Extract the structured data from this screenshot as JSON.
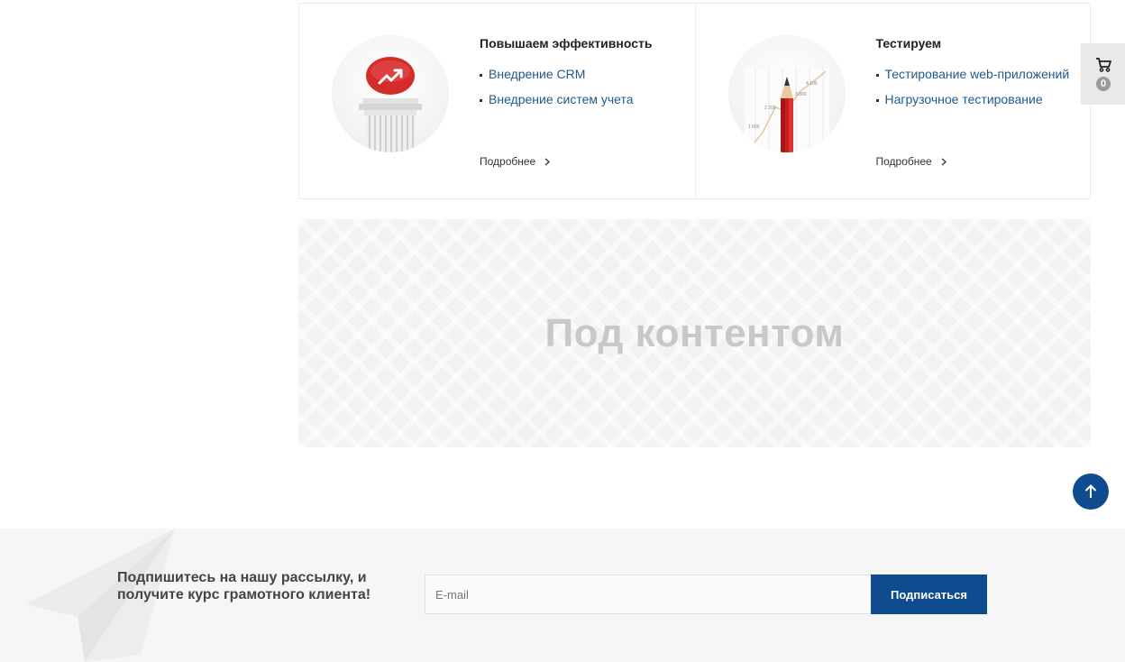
{
  "services": [
    {
      "title": "Повышаем эффективность",
      "items": [
        "Внедрение CRM",
        "Внедрение систем учета"
      ],
      "more_label": "Подробнее",
      "icon": "column-growth-icon"
    },
    {
      "title": "Тестируем",
      "items": [
        "Тестирование web-приложений",
        "Нагрузочное тестирование"
      ],
      "more_label": "Подробнее",
      "icon": "pencil-chart-icon",
      "chart_labels": [
        "1 600",
        "2 200",
        "3 800",
        "4 100"
      ]
    }
  ],
  "banner": {
    "text": "Под контентом"
  },
  "cart": {
    "count": "0",
    "icon": "cart-icon"
  },
  "scroll_top": {
    "icon": "arrow-up-icon"
  },
  "subscribe": {
    "heading": "Подпишитесь на нашу рассылку, и получите курс грамотного клиента!",
    "email_placeholder": "E-mail",
    "button_label": "Подписаться",
    "decor_icon": "paper-plane-icon"
  },
  "colors": {
    "accent": "#0f4c8f",
    "link": "#1f5a8c",
    "badge_red": "#d42b2b"
  }
}
